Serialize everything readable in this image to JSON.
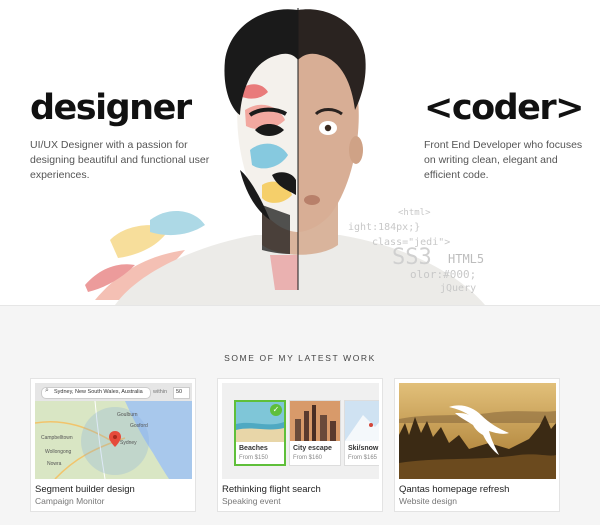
{
  "hero": {
    "designer_title": "designer",
    "designer_desc": "UI/UX Designer with a passion for designing beautiful and functional user experiences.",
    "coder_title": "<coder>",
    "coder_desc": "Front End Developer who focuses on writing clean, elegant and efficient code.",
    "code_snippets": [
      "<html>",
      "ight:184px;}",
      "class=\"jedi\">",
      "SS3",
      "HTML5",
      "olor:#000;",
      "jQuery"
    ]
  },
  "work": {
    "heading": "SOME OF MY LATEST WORK",
    "cards": [
      {
        "title": "Segment builder design",
        "subtitle": "Campaign Monitor",
        "map": {
          "search_value": "Sydney, New South Wales, Australia",
          "within_label": "within",
          "within_value": "50",
          "place_labels": [
            "Goulburn",
            "Gosford",
            "Sydney",
            "Campbelltown",
            "Wollongong",
            "Nowra"
          ]
        }
      },
      {
        "title": "Rethinking flight search",
        "subtitle": "Speaking event",
        "tiles": [
          {
            "label": "Beaches",
            "price": "From $150"
          },
          {
            "label": "City escape",
            "price": "From $160"
          },
          {
            "label": "Ski/snow",
            "price": "From $165"
          }
        ]
      },
      {
        "title": "Qantas homepage refresh",
        "subtitle": "Website design"
      }
    ]
  },
  "colors": {
    "accent_green": "#5fbf3a",
    "map_water": "#a8c8ec",
    "qantas_sky": "#c79a3e"
  }
}
